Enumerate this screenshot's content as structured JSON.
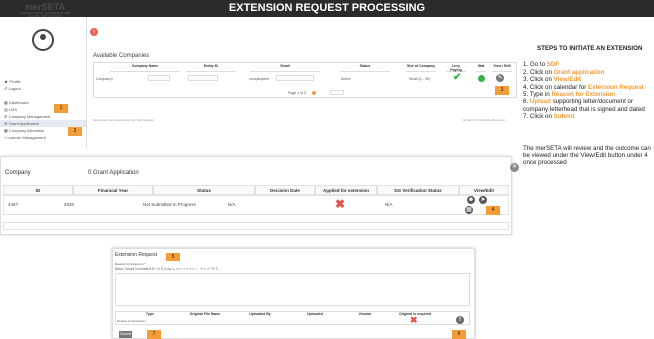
{
  "header": {
    "title": "EXTENSION REQUEST PROCESSING"
  },
  "sidebar": {
    "logo": "merSETA",
    "logo_sub": "MANUFACTURING, ENGINEERING AND RELATED SERVICES SETA",
    "items": [
      {
        "label": "Profile",
        "icon": "user-icon"
      },
      {
        "label": "Logout",
        "icon": "logout-icon"
      },
      {
        "label": "Dashboard",
        "icon": "dashboard-icon"
      },
      {
        "label": "LMS",
        "icon": "lms-icon"
      },
      {
        "label": "Company Management",
        "icon": "gear-icon"
      },
      {
        "label": "Grant Application",
        "icon": "list-icon"
      },
      {
        "label": "Company Allocation",
        "icon": "grid-icon"
      },
      {
        "label": "Learner Management",
        "icon": "plus-icon"
      }
    ]
  },
  "markers": {
    "m1": "1",
    "m2": "2",
    "m3": "3",
    "m4": "4",
    "m5": "5",
    "m6": "6",
    "m7": "7"
  },
  "companies": {
    "title": "Available Companies",
    "columns": [
      "Company Name",
      "Entity ID",
      "Email",
      "Status",
      "Size of Company",
      "Levy Paying",
      "Stat",
      "View / Edit"
    ],
    "row": {
      "name": "Company1",
      "email": "companymm",
      "status": "Active",
      "size": "Small (1 - 49)"
    },
    "pager": "Page   1 of 3"
  },
  "footer": {
    "left": "Developed and powered by Gijo Technologies",
    "right": "merSETA © All Rights Reserved"
  },
  "grant": {
    "company": "Company",
    "title": "0 Grant Application",
    "columns": [
      "ID",
      "Financial Year",
      "Status",
      "Decision Date",
      "Applied for extension",
      "DG Verification Status",
      "View/Edit"
    ],
    "row": {
      "id": "4457",
      "year": "2020",
      "status": "Not Submitted In Progress",
      "date": "N/A",
      "dg": "N/A"
    }
  },
  "ext": {
    "title": "Extension Request",
    "reason_label": "Reason for Extension *",
    "toolbar": "Basic Sans▾   Normal▾    A   B  I  U  S    A  Aa   x₂  x²   ≡   ≡   ≡   ≡   ≡    →  ⇥    ‹›  ☍  ☷   Tₓ",
    "doc_columns": [
      "Type",
      "Original File Name",
      "Uploaded By",
      "Uploaded",
      "Version",
      "Original is required"
    ],
    "doc_row_type": "Reason for Extension",
    "submit": "Submit"
  },
  "steps": {
    "title": "STEPS TO INITIATE AN EXTENSION",
    "s1a": "1. Go to ",
    "s1b": "SDF",
    "s2a": "2. Click on ",
    "s2b": "Grant application",
    "s3a": "3. Click on ",
    "s3b": "View/Edit",
    "s4a": "4. Click on calendar for ",
    "s4b": "Extension Request",
    "s5a": "5. Type in ",
    "s5b": "Reason for Extension",
    "s6a": "6. ",
    "s6b": "Upload",
    "s6c": " supporting letter/document or company letterhead that is signed and dated",
    "s7a": "7. Click on ",
    "s7b": "Submit",
    "note": "The merSETA will review and the outcome can be viewed under the View/Edit button under 4 once processed"
  },
  "colors": {
    "accent": "#f29d38",
    "header": "#2b2b2b",
    "check": "#35b34a",
    "cross": "#e5534b"
  }
}
